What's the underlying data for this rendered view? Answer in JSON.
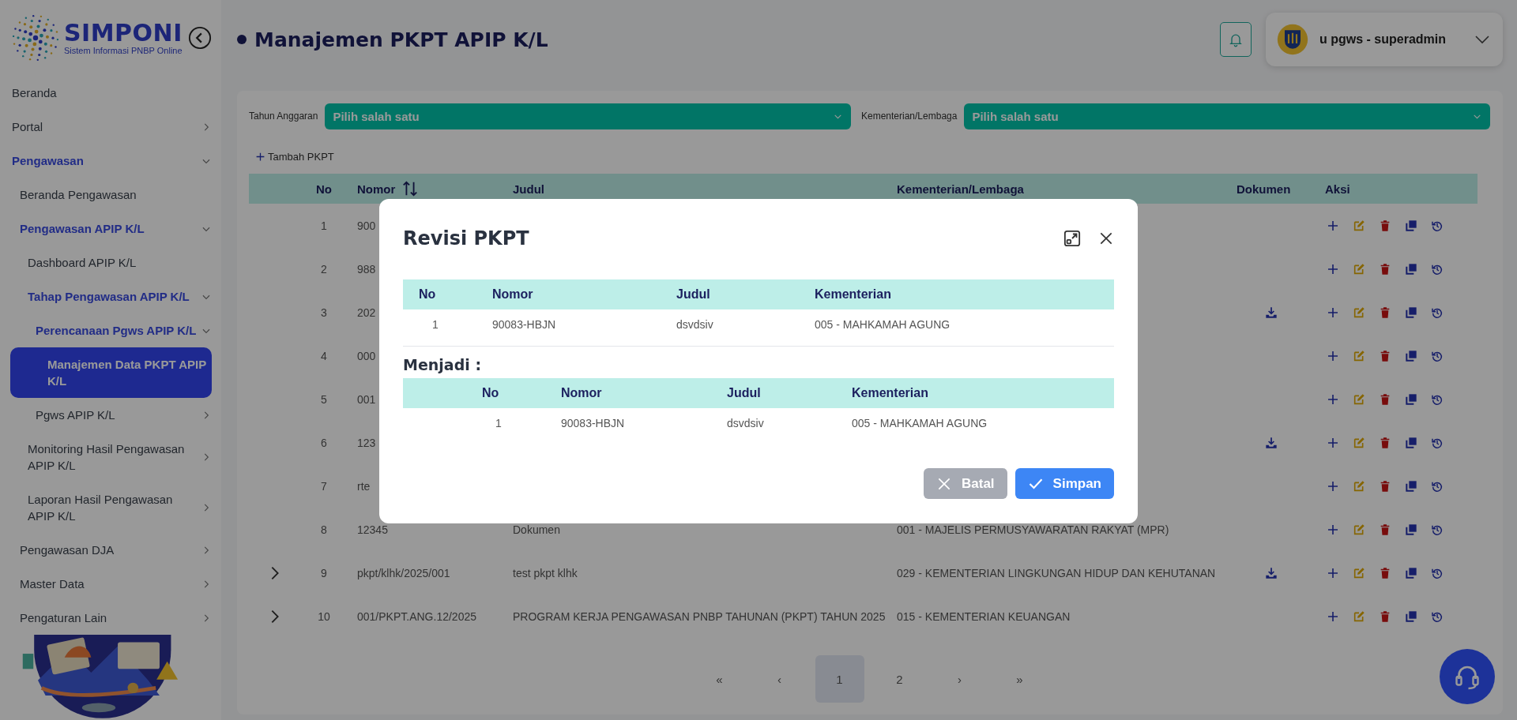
{
  "sidebar": {
    "logo": {
      "name": "SIMPONI",
      "tagline": "Sistem Informasi PNBP Online"
    },
    "items": [
      {
        "label": "Beranda",
        "selected": false
      },
      {
        "label": "Portal",
        "selected": false,
        "expanded": false
      },
      {
        "label": "Pengawasan",
        "selected": false,
        "expanded": true,
        "children": [
          {
            "label": "Beranda Pengawasan",
            "selected": false
          },
          {
            "label": "Pengawasan APIP K/L",
            "selected": false,
            "expanded": true,
            "children": [
              {
                "label": "Dashboard APIP K/L",
                "selected": false
              },
              {
                "label": "Tahap Pengawasan APIP K/L",
                "selected": false,
                "expanded": true,
                "children": [
                  {
                    "label": "Perencanaan Pgws APIP K/L",
                    "selected": false,
                    "expanded": true,
                    "children": [
                      {
                        "label": "Manajemen Data PKPT APIP K/L",
                        "selected": true
                      }
                    ]
                  },
                  {
                    "label": "Pgws APIP K/L",
                    "selected": false,
                    "expanded": false
                  }
                ]
              },
              {
                "label": "Monitoring Hasil Pengawasan APIP K/L",
                "selected": false,
                "expanded": false
              },
              {
                "label": "Laporan Hasil Pengawasan APIP K/L",
                "selected": false,
                "expanded": false
              }
            ]
          },
          {
            "label": "Pengawasan DJA",
            "selected": false,
            "expanded": false
          },
          {
            "label": "Master Data",
            "selected": false,
            "expanded": false
          },
          {
            "label": "Pengaturan Lain",
            "selected": false,
            "expanded": false
          }
        ]
      }
    ]
  },
  "header": {
    "title": "Manajemen PKPT APIP K/L",
    "user": "u pgws - superadmin"
  },
  "filters": [
    {
      "label": "Tahun Anggaran",
      "placeholder": "Pilih salah satu"
    },
    {
      "label": "Kementerian/Lembaga",
      "placeholder": "Pilih salah satu"
    }
  ],
  "add_button": "Tambah PKPT",
  "table": {
    "columns": [
      {
        "label": "No",
        "sortable": false
      },
      {
        "label": "Nomor",
        "sortable": true
      },
      {
        "label": "Judul",
        "sortable": false
      },
      {
        "label": "Kementerian/Lembaga",
        "sortable": false
      },
      {
        "label": "Dokumen",
        "sortable": false
      },
      {
        "label": "Aksi",
        "sortable": false
      }
    ],
    "rows": [
      {
        "no": "1",
        "nomor": "900",
        "expandable": false,
        "has_document": false
      },
      {
        "no": "2",
        "nomor": "988",
        "expandable": false,
        "has_document": false
      },
      {
        "no": "3",
        "nomor": "202",
        "expandable": false,
        "has_document": true
      },
      {
        "no": "4",
        "nomor": "000",
        "expandable": false,
        "has_document": false
      },
      {
        "no": "5",
        "nomor": "001",
        "expandable": false,
        "has_document": false
      },
      {
        "no": "6",
        "nomor": "123",
        "expandable": false,
        "has_document": true
      },
      {
        "no": "7",
        "nomor": "rte",
        "expandable": false,
        "has_document": false
      },
      {
        "no": "8",
        "nomor": "12345",
        "judul": "Dokumen",
        "kementerian": "001 - MAJELIS PERMUSYAWARATAN RAKYAT (MPR)",
        "expandable": false,
        "has_document": false
      },
      {
        "no": "9",
        "nomor": "pkpt/klhk/2025/001",
        "judul": "test pkpt klhk",
        "kementerian": "029 - KEMENTERIAN LINGKUNGAN HIDUP DAN KEHUTANAN",
        "expandable": true,
        "has_document": true
      },
      {
        "no": "10",
        "nomor": "001/PKPT.ANG.12/2025",
        "judul": "PROGRAM KERJA PENGAWASAN PNBP TAHUNAN (PKPT) TAHUN 2025",
        "kementerian": "015 - KEMENTERIAN KEUANGAN",
        "expandable": true,
        "has_document": false
      }
    ]
  },
  "pagination": [
    {
      "label": "«",
      "selected": false
    },
    {
      "label": "‹",
      "selected": false
    },
    {
      "label": "1",
      "selected": true
    },
    {
      "label": "2",
      "selected": false
    },
    {
      "label": "›",
      "selected": false
    },
    {
      "label": "»",
      "selected": false
    }
  ],
  "modal": {
    "title": "Revisi PKPT",
    "original": {
      "expand_column": false,
      "columns": [
        "No",
        "Nomor",
        "Judul",
        "Kementerian"
      ],
      "rows": [
        [
          "1",
          "90083-HBJN",
          "dsvdsiv",
          "005 - MAHKAMAH AGUNG"
        ]
      ]
    },
    "section_label": "Menjadi :",
    "revised": {
      "expand_column": true,
      "columns": [
        "No",
        "Nomor",
        "Judul",
        "Kementerian"
      ],
      "rows": [
        [
          "1",
          "90083-HBJN",
          "dsvdsiv",
          "005 - MAHKAMAH AGUNG"
        ]
      ]
    },
    "buttons": [
      {
        "label": "Batal",
        "kind": "cancel"
      },
      {
        "label": "Simpan",
        "kind": "save"
      }
    ]
  }
}
